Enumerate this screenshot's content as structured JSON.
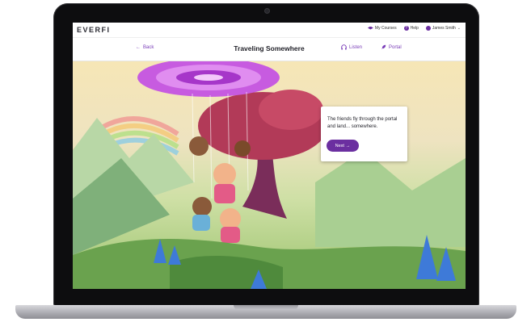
{
  "app": {
    "logo": "EVERFI"
  },
  "topnav": {
    "my_courses": "My Courses",
    "help": "Help",
    "user": "James Smith"
  },
  "lesson": {
    "back": "Back",
    "title": "Traveling Somewhere",
    "listen": "Listen",
    "portal": "Portal"
  },
  "dialog": {
    "text": "The friends fly through the portal and land... somewhere.",
    "next": "Next"
  },
  "colors": {
    "accent": "#6b2fa0",
    "portal": "#c75be0"
  }
}
